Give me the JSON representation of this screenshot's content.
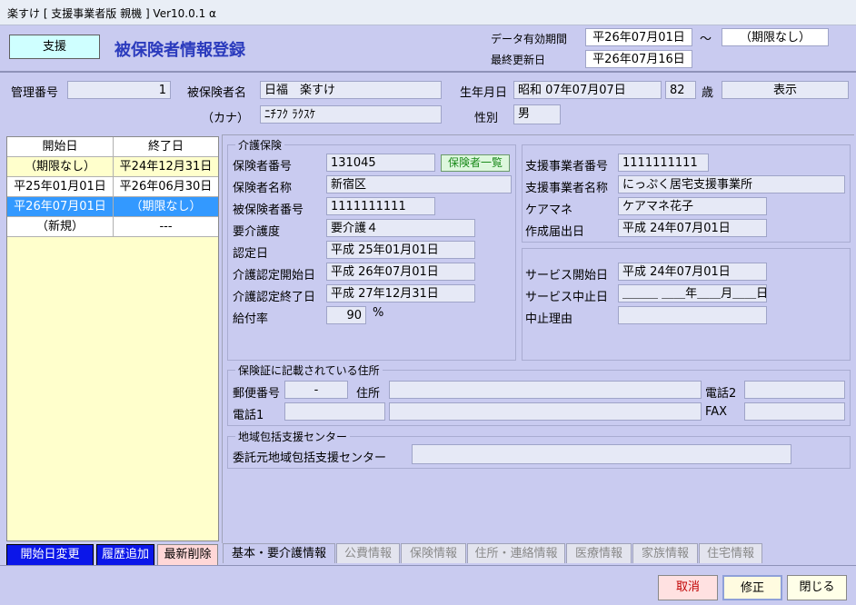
{
  "window": {
    "title": "楽すけ [ 支援事業者版 親機 ] Ver10.0.1 α"
  },
  "header": {
    "mode_button": "支援",
    "page_title": "被保険者情報登録",
    "valid_period_label": "データ有効期間",
    "valid_from": "平26年07月01日",
    "tilde": "〜",
    "valid_to": "（期限なし）",
    "last_updated_label": "最終更新日",
    "last_updated": "平26年07月16日"
  },
  "person": {
    "mgmt_no_label": "管理番号",
    "mgmt_no": "1",
    "name_label": "被保険者名",
    "name": "日福　楽すけ",
    "kana_label": "（カナ）",
    "kana": "ﾆﾁﾌｸ ﾗｸｽｹ",
    "birth_label": "生年月日",
    "birth": "昭和 07年07月07日",
    "age": "82",
    "age_unit": "歳",
    "display_button": "表示",
    "gender_label": "性別",
    "gender": "男"
  },
  "history": {
    "columns": [
      "開始日",
      "終了日"
    ],
    "rows": [
      {
        "start": "（期限なし）",
        "end": "平24年12月31日"
      },
      {
        "start": "平25年01月01日",
        "end": "平26年06月30日"
      },
      {
        "start": "平26年07月01日",
        "end": "（期限なし）"
      },
      {
        "start": "（新規）",
        "end": "---"
      }
    ],
    "buttons": {
      "change_start": "開始日変更",
      "add_history": "履歴追加",
      "delete_latest": "最新削除"
    }
  },
  "care_insurance": {
    "group_title": "介護保険",
    "insurer_no_label": "保険者番号",
    "insurer_no": "131045",
    "insurer_list_button": "保険者一覧",
    "insurer_name_label": "保険者名称",
    "insurer_name": "新宿区",
    "insured_no_label": "被保険者番号",
    "insured_no": "1111111111",
    "care_level_label": "要介護度",
    "care_level": "要介護４",
    "cert_date_label": "認定日",
    "cert_date": "平成 25年01月01日",
    "cert_start_label": "介護認定開始日",
    "cert_start": "平成 26年07月01日",
    "cert_end_label": "介護認定終了日",
    "cert_end": "平成 27年12月31日",
    "benefit_rate_label": "給付率",
    "benefit_rate": "90",
    "percent": "%"
  },
  "provider": {
    "provider_no_label": "支援事業者番号",
    "provider_no": "1111111111",
    "provider_name_label": "支援事業者名称",
    "provider_name": "にっぷく居宅支援事業所",
    "care_manager_label": "ケアマネ",
    "care_manager": "ケアマネ花子",
    "created_label": "作成届出日",
    "created": "平成 24年07月01日",
    "service_start_label": "サービス開始日",
    "service_start": "平成 24年07月01日",
    "service_stop_label": "サービス中止日",
    "service_stop": "＿＿＿ ＿＿年＿＿月＿＿日",
    "stop_reason_label": "中止理由",
    "stop_reason": ""
  },
  "address": {
    "group_title": "保険証に記載されている住所",
    "postal_label": "郵便番号",
    "postal": "-",
    "address_label": "住所",
    "address": "",
    "address2": "",
    "phone1_label": "電話1",
    "phone1": "",
    "phone2_label": "電話2",
    "phone2": "",
    "fax_label": "FAX",
    "fax": ""
  },
  "center": {
    "group_title": "地域包括支援センター",
    "center_label": "委託元地域包括支援センター",
    "center": ""
  },
  "tabs": [
    "基本・要介護情報",
    "公費情報",
    "保険情報",
    "住所・連絡情報",
    "医療情報",
    "家族情報",
    "住宅情報"
  ],
  "actions": {
    "cancel": "取消",
    "modify": "修正",
    "close": "閉じる"
  }
}
